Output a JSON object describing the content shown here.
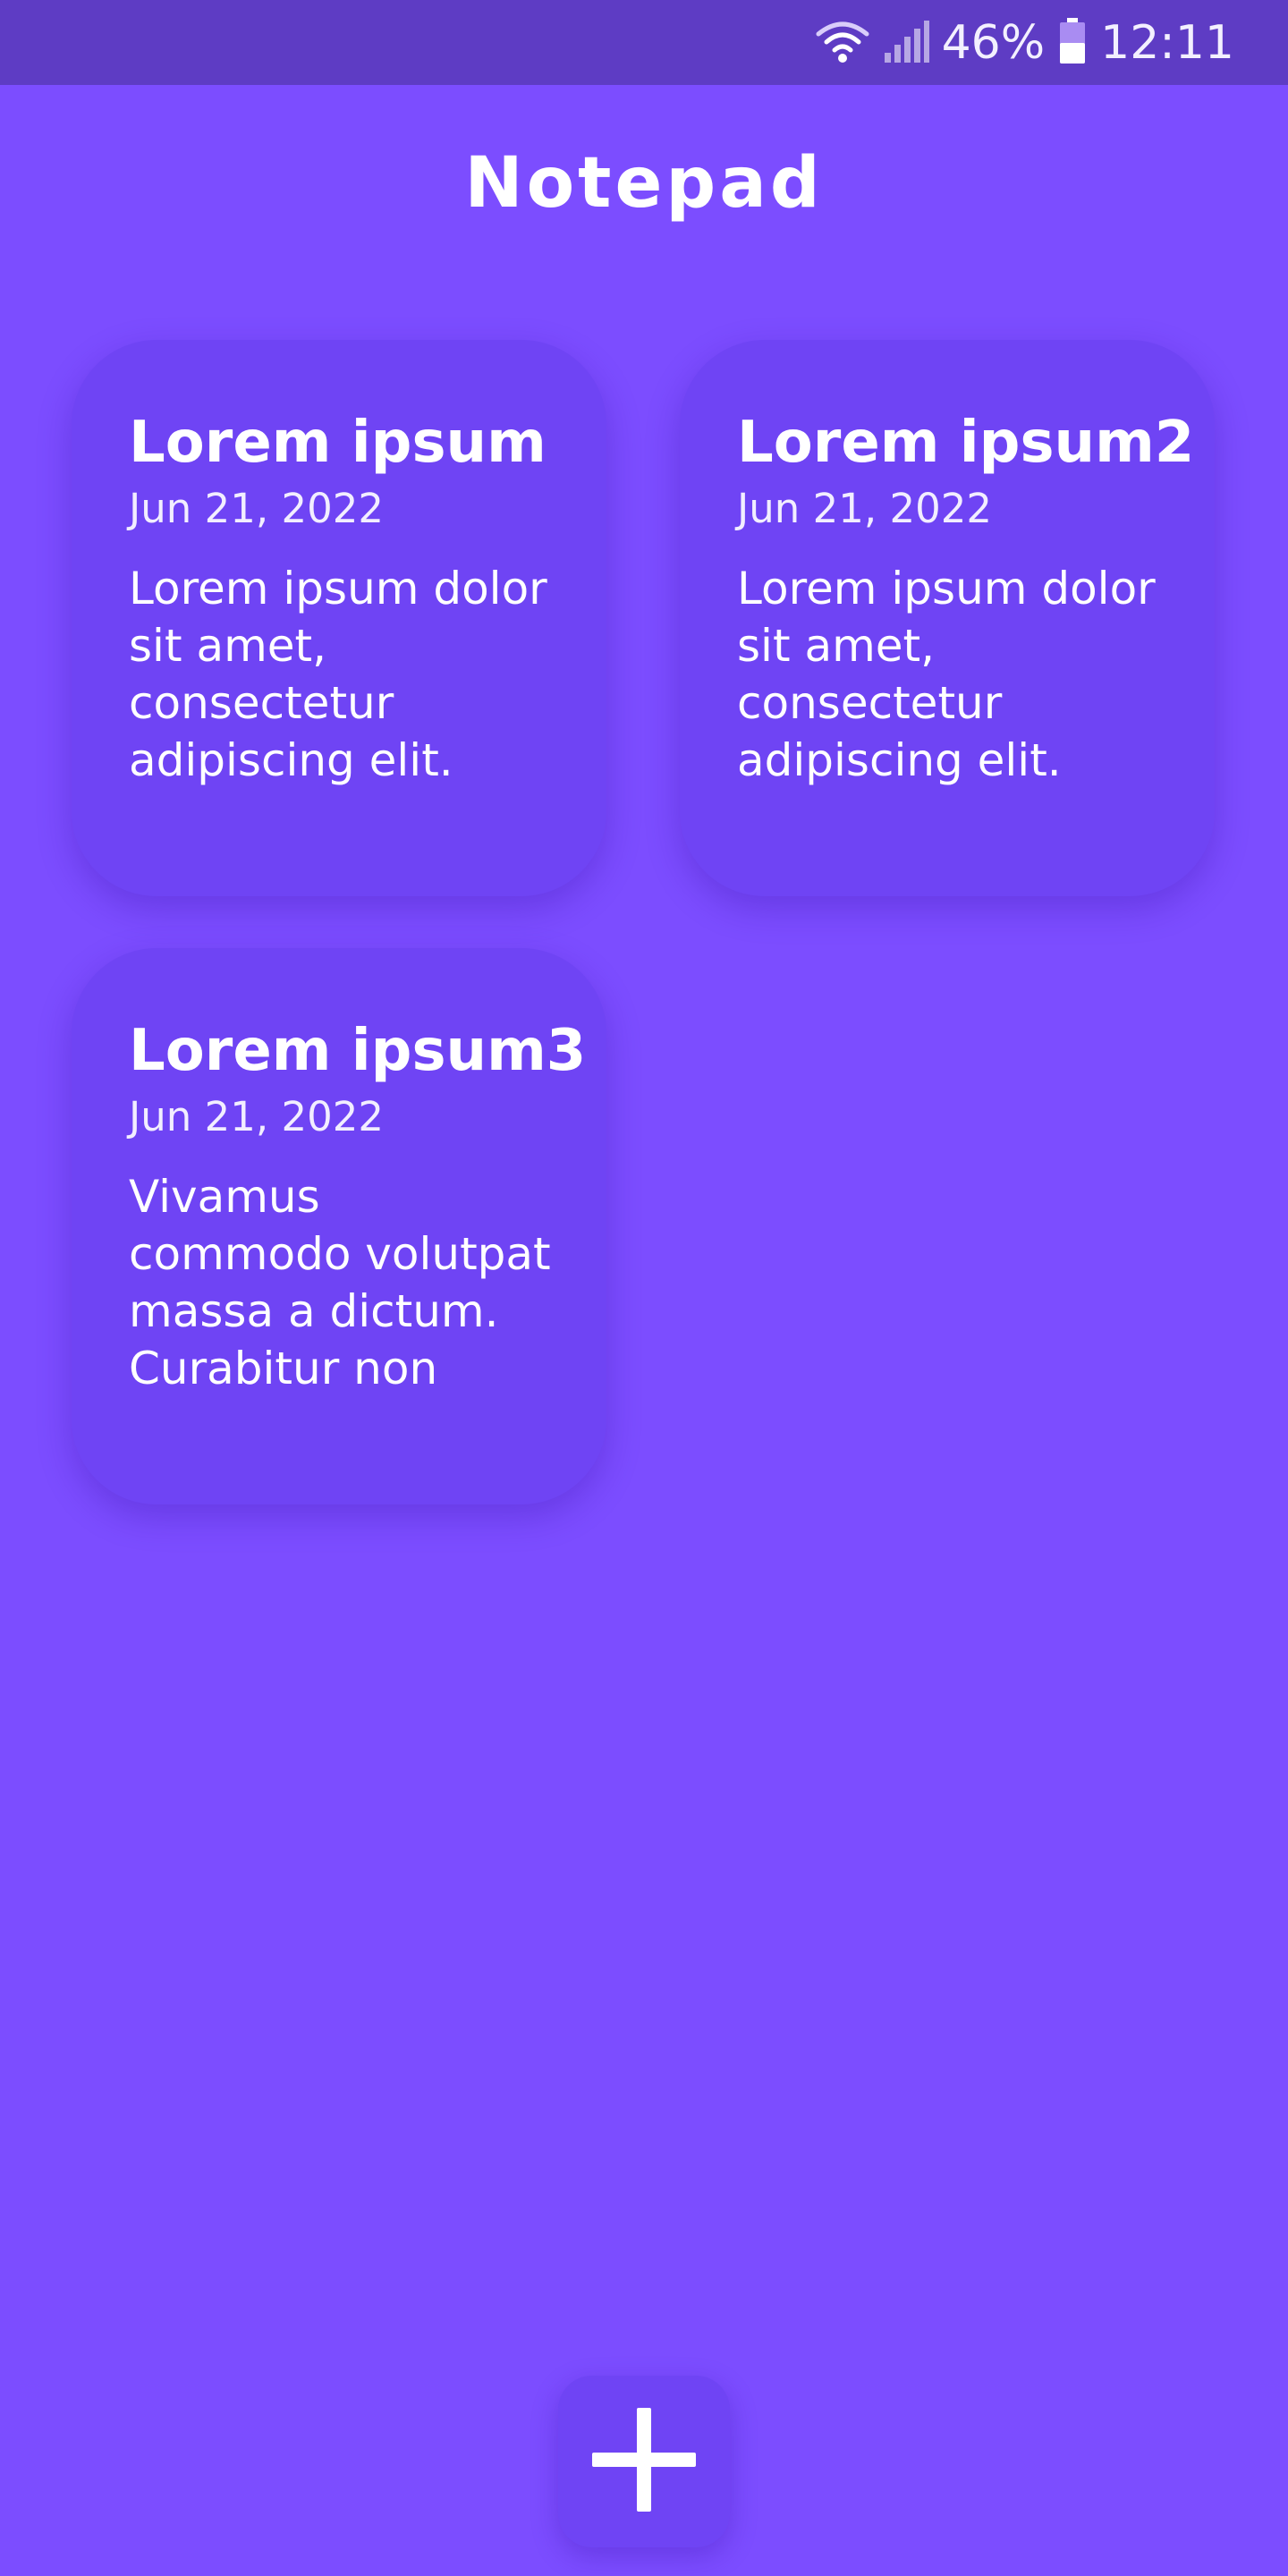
{
  "status_bar": {
    "wifi_icon": "wifi-icon",
    "signal_icon": "signal-icon",
    "battery_icon": "battery-icon",
    "battery": "46%",
    "time": "12:11"
  },
  "app": {
    "title": "Notepad"
  },
  "notes": [
    {
      "title": "Lorem ipsum",
      "date": "Jun 21, 2022",
      "body": "Lorem ipsum dolor sit amet, consectetur adipiscing elit."
    },
    {
      "title": "Lorem ipsum2",
      "date": "Jun 21, 2022",
      "body": "Lorem ipsum dolor sit amet, consectetur adipiscing elit."
    },
    {
      "title": "Lorem ipsum3",
      "date": "Jun 21, 2022",
      "body": "Vivamus commodo volutpat massa a dictum. Curabitur non"
    }
  ],
  "fab": {
    "icon": "plus-icon"
  },
  "colors": {
    "background": "#7c4dff",
    "status_bar": "#5e3cc4",
    "card": "#6f44f4",
    "text": "#ffffff"
  }
}
